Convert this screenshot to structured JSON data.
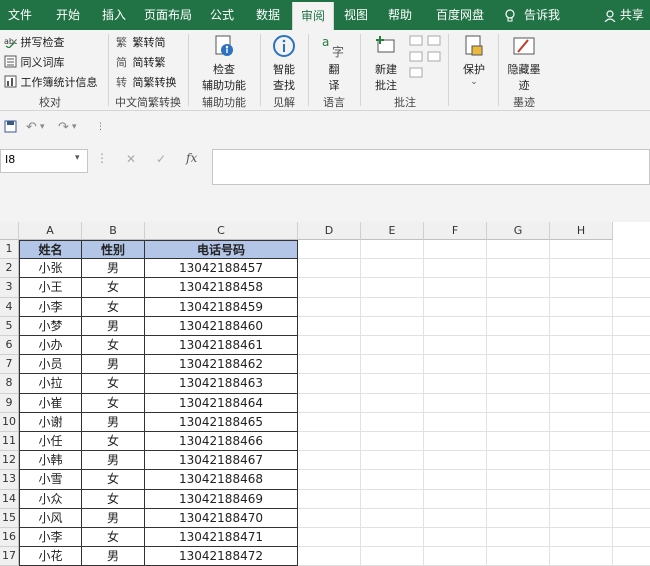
{
  "tabs": [
    {
      "label": "文件"
    },
    {
      "label": "开始"
    },
    {
      "label": "插入"
    },
    {
      "label": "页面布局"
    },
    {
      "label": "公式"
    },
    {
      "label": "数据"
    },
    {
      "label": "审阅"
    },
    {
      "label": "视图"
    },
    {
      "label": "帮助"
    },
    {
      "label": "百度网盘"
    }
  ],
  "tellme": "告诉我",
  "share": "共享",
  "ribbon": {
    "proof": {
      "spell": "拼写检查",
      "thesaurus": "同义词库",
      "stats": "工作簿统计信息",
      "group": "校对"
    },
    "chinese": {
      "t2s": "繁转简",
      "s2t": "简转繁",
      "convert": "简繁转换",
      "group": "中文简繁转换"
    },
    "access": {
      "check1": "检查",
      "check2": "辅助功能",
      "group": "辅助功能"
    },
    "insights": {
      "smart1": "智能",
      "smart2": "查找",
      "group": "见解"
    },
    "language": {
      "translate1": "翻",
      "translate2": "译",
      "group": "语言"
    },
    "comments": {
      "new1": "新建",
      "new2": "批注",
      "group": "批注"
    },
    "protect": {
      "label": "保护"
    },
    "ink": {
      "hide1": "隐藏墨",
      "hide2": "迹",
      "group": "墨迹"
    }
  },
  "namebox": "I8",
  "fx": "fx",
  "columns": [
    "A",
    "B",
    "C",
    "D",
    "E",
    "F",
    "G",
    "H"
  ],
  "table": {
    "header": [
      "姓名",
      "性别",
      "电话号码"
    ],
    "rows": [
      [
        "小张",
        "男",
        "13042188457"
      ],
      [
        "小王",
        "女",
        "13042188458"
      ],
      [
        "小李",
        "女",
        "13042188459"
      ],
      [
        "小梦",
        "男",
        "13042188460"
      ],
      [
        "小办",
        "女",
        "13042188461"
      ],
      [
        "小员",
        "男",
        "13042188462"
      ],
      [
        "小拉",
        "女",
        "13042188463"
      ],
      [
        "小崔",
        "女",
        "13042188464"
      ],
      [
        "小谢",
        "男",
        "13042188465"
      ],
      [
        "小任",
        "女",
        "13042188466"
      ],
      [
        "小韩",
        "男",
        "13042188467"
      ],
      [
        "小雪",
        "女",
        "13042188468"
      ],
      [
        "小众",
        "女",
        "13042188469"
      ],
      [
        "小风",
        "男",
        "13042188470"
      ],
      [
        "小李",
        "女",
        "13042188471"
      ],
      [
        "小花",
        "男",
        "13042188472"
      ]
    ]
  },
  "row_numbers": [
    "1",
    "2",
    "3",
    "4",
    "5",
    "6",
    "7",
    "8",
    "9",
    "10",
    "11",
    "12",
    "13",
    "14",
    "15",
    "16",
    "17"
  ]
}
